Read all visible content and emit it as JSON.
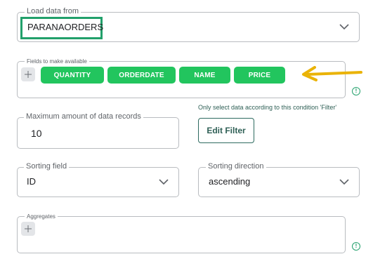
{
  "load_data": {
    "legend": "Load data from",
    "value": "PARANAORDERS",
    "highlight_color": "#22a06b",
    "icon": "chevron-down-icon"
  },
  "fields": {
    "legend": "Fields to make available",
    "chips": [
      "QUANTITY",
      "ORDERDATE",
      "NAME",
      "PRICE"
    ],
    "chip_color": "#22c55e",
    "add_icon": "plus-icon",
    "info_icon": "info-icon",
    "info_glyph": "!"
  },
  "annotation": {
    "arrow_color": "#eab308",
    "icon": "arrow-left-icon"
  },
  "max_records": {
    "legend": "Maximum amount of data records",
    "value": "10"
  },
  "filter": {
    "hint": "Only select data according to this condition 'Filter'",
    "button_label": "Edit Filter"
  },
  "sorting_field": {
    "legend": "Sorting field",
    "value": "ID"
  },
  "sorting_direction": {
    "legend": "Sorting direction",
    "value": "ascending"
  },
  "aggregates": {
    "legend": "Aggregates",
    "add_icon": "plus-icon",
    "info_icon": "info-icon",
    "info_glyph": "!"
  }
}
